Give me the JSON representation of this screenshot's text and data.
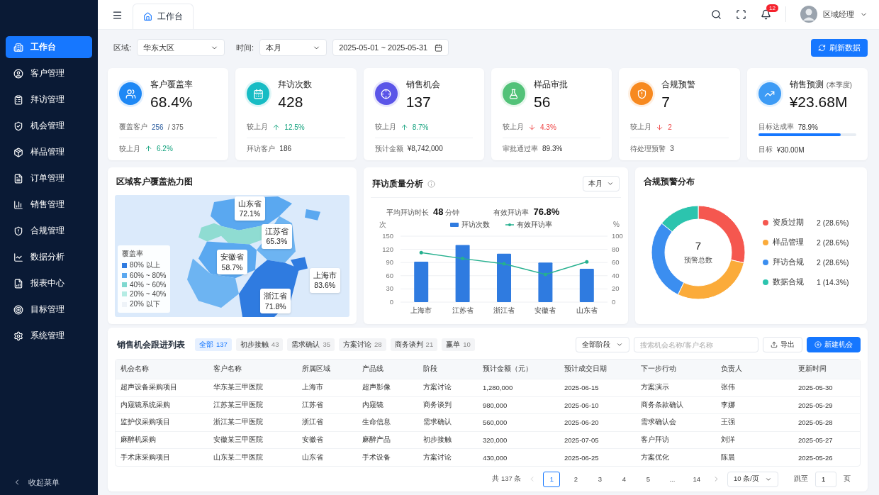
{
  "sidebar": {
    "items": [
      {
        "label": "工作台",
        "kind": "dashboard",
        "selected": true
      },
      {
        "label": "客户管理",
        "kind": "customer",
        "selected": false
      },
      {
        "label": "拜访管理",
        "kind": "visit",
        "selected": false
      },
      {
        "label": "机会管理",
        "kind": "opportunity",
        "selected": false
      },
      {
        "label": "样品管理",
        "kind": "sample",
        "selected": false
      },
      {
        "label": "订单管理",
        "kind": "order",
        "selected": false
      },
      {
        "label": "销售管理",
        "kind": "sales",
        "selected": false
      },
      {
        "label": "合规管理",
        "kind": "compliance",
        "selected": false
      },
      {
        "label": "数据分析",
        "kind": "analysis",
        "selected": false
      },
      {
        "label": "报表中心",
        "kind": "report",
        "selected": false
      },
      {
        "label": "目标管理",
        "kind": "target",
        "selected": false
      },
      {
        "label": "系统管理",
        "kind": "settings",
        "selected": false
      }
    ],
    "collapse": "收起菜单"
  },
  "header": {
    "tab": "工作台",
    "notifications": "12",
    "user": "区域经理"
  },
  "filters": {
    "region_label": "区域:",
    "region": "华东大区",
    "time_label": "时间:",
    "time": "本月",
    "date_range": "2025-05-01 ~ 2025-05-31",
    "refresh": "刷新数据"
  },
  "kpis": [
    {
      "title": "客户覆盖率",
      "value": "68.4%",
      "kind": "users",
      "color": "#1e88f5",
      "lines": [
        {
          "kind": "ratio",
          "label": "覆盖客户",
          "value": "256",
          "total": "/ 375"
        },
        {
          "kind": "rise",
          "label": "较上月",
          "value": "6.2%"
        }
      ]
    },
    {
      "title": "拜访次数",
      "value": "428",
      "kind": "calendar",
      "color": "#17bcc4",
      "lines": [
        {
          "kind": "rise",
          "label": "较上月",
          "value": "12.5%"
        },
        {
          "kind": "stat",
          "label": "拜访客户",
          "value": "186"
        }
      ]
    },
    {
      "title": "销售机会",
      "value": "137",
      "kind": "target",
      "color": "#5b55e8",
      "lines": [
        {
          "kind": "rise",
          "label": "较上月",
          "value": "8.7%"
        },
        {
          "kind": "stat",
          "label": "预计金额",
          "value": "¥8,742,000"
        }
      ]
    },
    {
      "title": "样品审批",
      "value": "56",
      "kind": "flask",
      "color": "#52c278",
      "lines": [
        {
          "kind": "fall",
          "label": "较上月",
          "value": "4.3%"
        },
        {
          "kind": "stat",
          "label": "审批通过率",
          "value": "89.3%"
        }
      ]
    },
    {
      "title": "合规预警",
      "value": "7",
      "kind": "shield",
      "color": "#f7891f",
      "lines": [
        {
          "kind": "fall",
          "label": "较上月",
          "value": "2"
        },
        {
          "kind": "stat",
          "label": "待处理预警",
          "value": "3"
        }
      ]
    },
    {
      "title": "销售预测",
      "note": "(本季度)",
      "value": "¥23.68M",
      "kind": "chart",
      "color": "#3d9bf5",
      "lines": [
        {
          "kind": "progress",
          "label": "目标达成率",
          "value": "78.9%",
          "level": 0.84
        },
        {
          "kind": "stat",
          "label": "目标",
          "value": "¥30.00M"
        }
      ]
    }
  ],
  "map": {
    "title": "区域客户覆盖热力图",
    "callouts": [
      {
        "region": "山东省",
        "value": "72.1%"
      },
      {
        "region": "江苏省",
        "value": "65.3%"
      },
      {
        "region": "安徽省",
        "value": "58.7%"
      },
      {
        "region": "上海市",
        "value": "83.6%"
      },
      {
        "region": "浙江省",
        "value": "71.8%"
      }
    ],
    "legend": {
      "title": "覆盖率",
      "items": [
        {
          "label": "80% 以上",
          "color": "#2f7be0"
        },
        {
          "label": "60% ~ 80%",
          "color": "#5aa8f0"
        },
        {
          "label": "40% ~ 60%",
          "color": "#7fd8d0"
        },
        {
          "label": "20% ~ 40%",
          "color": "#b5ece4"
        },
        {
          "label": "20% 以下",
          "color": "#eef3f8"
        }
      ]
    }
  },
  "visits": {
    "title": "拜访质量分析",
    "period": "本月",
    "metrics": [
      {
        "label": "平均拜访时长",
        "value": "48",
        "unit": "分钟"
      },
      {
        "label": "有效拜访率",
        "value": "76.8%"
      }
    ],
    "chart_data": {
      "type": "bar",
      "categories": [
        "上海市",
        "江苏省",
        "浙江省",
        "安徽省",
        "山东省"
      ],
      "series": [
        {
          "name": "拜访次数",
          "color": "#2f7be0",
          "values": [
            92,
            130,
            110,
            90,
            76
          ]
        }
      ],
      "grid": true,
      "ylabel": "次",
      "ylim": [
        0,
        150
      ],
      "yticks": [
        0,
        30,
        60,
        90,
        120,
        150
      ]
    },
    "rate_line": {
      "chart_data": {
        "type": "line",
        "series": [
          {
            "name": "有效拜访率",
            "color": "#26b08f",
            "values": [
              75,
              66,
              58,
              42,
              61
            ]
          }
        ],
        "ylabel": "%",
        "ylim": [
          0,
          100
        ],
        "yticks": [
          0,
          20,
          40,
          60,
          80,
          100
        ]
      }
    }
  },
  "compliance": {
    "title": "合规预警分布",
    "total": "7",
    "total_label": "预警总数",
    "chart_data": {
      "type": "donut",
      "categories": [
        "资质过期",
        "样品管理",
        "拜访合规",
        "数据合规"
      ],
      "values": [
        28.6,
        28.6,
        28.6,
        14.3
      ]
    },
    "legend": [
      {
        "value": "2 (28.6%)",
        "color": "#f5574f"
      },
      {
        "value": "2 (28.6%)",
        "color": "#fbab3a"
      },
      {
        "value": "2 (28.6%)",
        "color": "#3b8ef0"
      },
      {
        "value": "1 (14.3%)",
        "color": "#2cc4ae"
      }
    ]
  },
  "table": {
    "title": "销售机会跟进列表",
    "filters": [
      {
        "label": "全部",
        "count": "137",
        "selected": true
      },
      {
        "label": "初步接触",
        "count": "43",
        "selected": false
      },
      {
        "label": "需求确认",
        "count": "35",
        "selected": false
      },
      {
        "label": "方案讨论",
        "count": "28",
        "selected": false
      },
      {
        "label": "商务谈判",
        "count": "21",
        "selected": false
      },
      {
        "label": "赢单",
        "count": "10",
        "selected": false
      }
    ],
    "stage_select": "全部阶段",
    "search_placeholder": "搜索机会名称/客户名称",
    "export": "导出",
    "create": "新建机会",
    "columns": [
      "机会名称",
      "客户名称",
      "所属区域",
      "产品线",
      "阶段",
      "预计金额（元）",
      "预计成交日期",
      "下一步行动",
      "负责人",
      "更新时间"
    ],
    "rows": [
      [
        "超声设备采购项目",
        "华东某三甲医院",
        "上海市",
        "超声影像",
        "方案讨论",
        "1,280,000",
        "2025-06-15",
        "方案演示",
        "张伟",
        "2025-05-30"
      ],
      [
        "内窥镜系统采购",
        "江苏某三甲医院",
        "江苏省",
        "内窥镜",
        "商务谈判",
        "980,000",
        "2025-06-10",
        "商务条款确认",
        "李娜",
        "2025-05-29"
      ],
      [
        "监护仪采购项目",
        "浙江某二甲医院",
        "浙江省",
        "生命信息",
        "需求确认",
        "560,000",
        "2025-06-20",
        "需求确认会",
        "王强",
        "2025-05-28"
      ],
      [
        "麻醉机采购",
        "安徽某三甲医院",
        "安徽省",
        "麻醉产品",
        "初步接触",
        "320,000",
        "2025-07-05",
        "客户拜访",
        "刘洋",
        "2025-05-27"
      ],
      [
        "手术床采购项目",
        "山东某二甲医院",
        "山东省",
        "手术设备",
        "方案讨论",
        "430,000",
        "2025-06-25",
        "方案优化",
        "陈晨",
        "2025-05-26"
      ]
    ],
    "pagination": {
      "total": "共 137 条",
      "pages": [
        {
          "label": "1",
          "selected": true
        },
        {
          "label": "2",
          "selected": false
        },
        {
          "label": "3",
          "selected": false
        },
        {
          "label": "4",
          "selected": false
        },
        {
          "label": "5",
          "selected": false
        },
        {
          "label": "...",
          "selected": false
        },
        {
          "label": "14",
          "selected": false
        }
      ],
      "page_size": "10 条/页",
      "jump_label": "跳至",
      "jump_value": "1",
      "page_suffix": "页"
    }
  }
}
